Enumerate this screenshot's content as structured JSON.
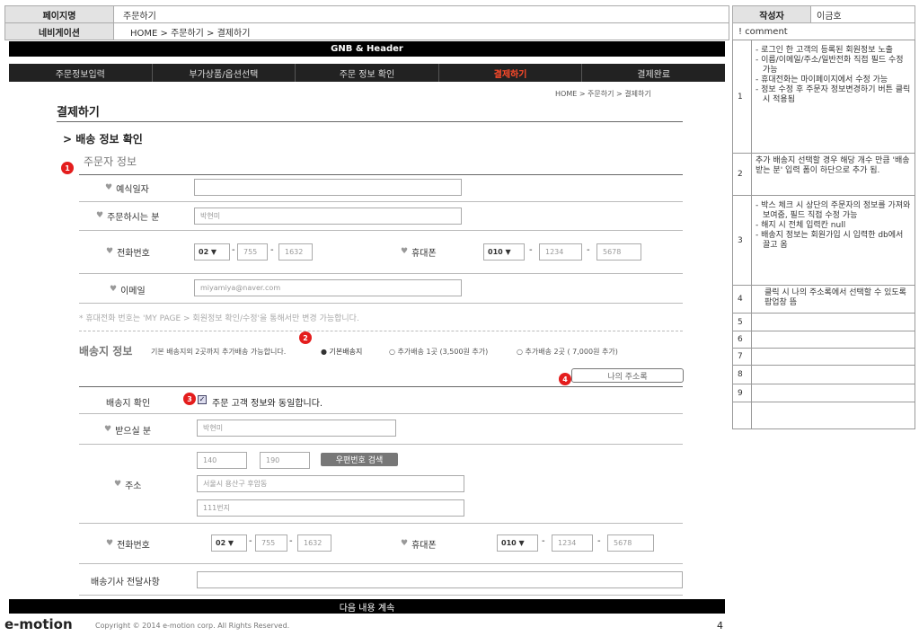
{
  "header": {
    "page_name_label": "페이지명",
    "page_name": "주문하기",
    "nav_label": "네비게이션",
    "nav_path": "HOME > 주문하기 > 결제하기",
    "author_label": "작성자",
    "author": "이금호",
    "comment_label": "! comment"
  },
  "gnb_bar": "GNB & Header",
  "steps": [
    "주문정보입력",
    "부가상품/옵션선택",
    "주문 정보 확인",
    "결제하기",
    "결제완료"
  ],
  "breadcrumb": "HOME > 주문하기 > 결제하기",
  "page_title": "결제하기",
  "section_title": "> 배송 정보 확인",
  "orderer": {
    "title": "주문자 정보",
    "fields": {
      "date_label": "예식일자",
      "name_label": "주문하시는 분",
      "name_value": "박현미",
      "phone_label": "전화번호",
      "phone_prefix": "02",
      "phone_mid": "755",
      "phone_last": "1632",
      "mobile_label": "휴대폰",
      "mobile_prefix": "010",
      "mobile_mid": "1234",
      "mobile_last": "5678",
      "email_label": "이메일",
      "email_value": "miyamiya@naver.com"
    },
    "notice": "* 휴대전화 번호는 'MY PAGE > 회원정보 확인/수정'을 통해서만 변경 가능합니다."
  },
  "shipping": {
    "title": "배송지 정보",
    "desc": "기본 배송지외 2곳까지 추가배송 가능합니다.",
    "options": [
      "기본배송지",
      "추가배송 1곳 (3,500원 추가)",
      "추가배송 2곳 ( 7,000원 추가)"
    ],
    "address_book_button": "나의 주소록",
    "confirm_label": "배송지 확인",
    "same_as_orderer": "주문 고객 정보와 동일합니다.",
    "receiver_label": "받으실 분",
    "receiver_value": "박현미",
    "address_label": "주소",
    "zip1": "140",
    "zip2": "190",
    "zip_search_button": "우편번호 검색",
    "addr1": "서울시 용산구 후암동",
    "addr2": "111번지",
    "phone_label": "전화번호",
    "phone_prefix": "02",
    "phone_mid": "755",
    "phone_last": "1632",
    "mobile_label": "휴대폰",
    "mobile_prefix": "010",
    "mobile_mid": "1234",
    "mobile_last": "5678",
    "driver_note_label": "배송기사 전달사항"
  },
  "continue_bar": "다음 내용 계속",
  "footer": {
    "logo": "e-motion",
    "copyright": "Copyright © 2014 e-motion corp. All Rights Reserved.",
    "page_number": "4"
  },
  "badges": [
    "1",
    "2",
    "3",
    "4"
  ],
  "comments": [
    {
      "num": "1",
      "lines": [
        "- 로그인 한 고객의 등록된 회원정보 노출",
        "- 이름/이메일/주소/일반전화 직접 필드 수정 가능",
        "- 휴대전화는 마이페이지에서 수정 가능",
        "- 정보 수정 후 주문자 정보변경하기 버튼 클릭 시 적용됨"
      ]
    },
    {
      "num": "2",
      "lines": [
        "추가 배송지 선택할 경우 해당 개수 만큼 '배송 받는 분' 입력 폼이 하단으로 추가 됨."
      ]
    },
    {
      "num": "3",
      "lines": [
        "- 박스 체크 시 상단의 주문자의 정보를 가져와 보여줌, 필드 직접 수정 가능",
        "- 해지 시 전체 입력칸 null",
        "- 배송지 정보는 회원가입 시 입력한 db에서 끌고 옴"
      ]
    },
    {
      "num": "4",
      "lines": [
        "클릭 시 나의 주소록에서 선택할 수 있도록 팝업창 뜸"
      ]
    },
    {
      "num": "5",
      "lines": []
    },
    {
      "num": "6",
      "lines": []
    },
    {
      "num": "7",
      "lines": []
    },
    {
      "num": "8",
      "lines": []
    },
    {
      "num": "9",
      "lines": []
    },
    {
      "num": "",
      "lines": []
    }
  ],
  "colors": {
    "accent": "#ff4a2a",
    "badge": "#e41d1d",
    "bar": "#000000"
  }
}
